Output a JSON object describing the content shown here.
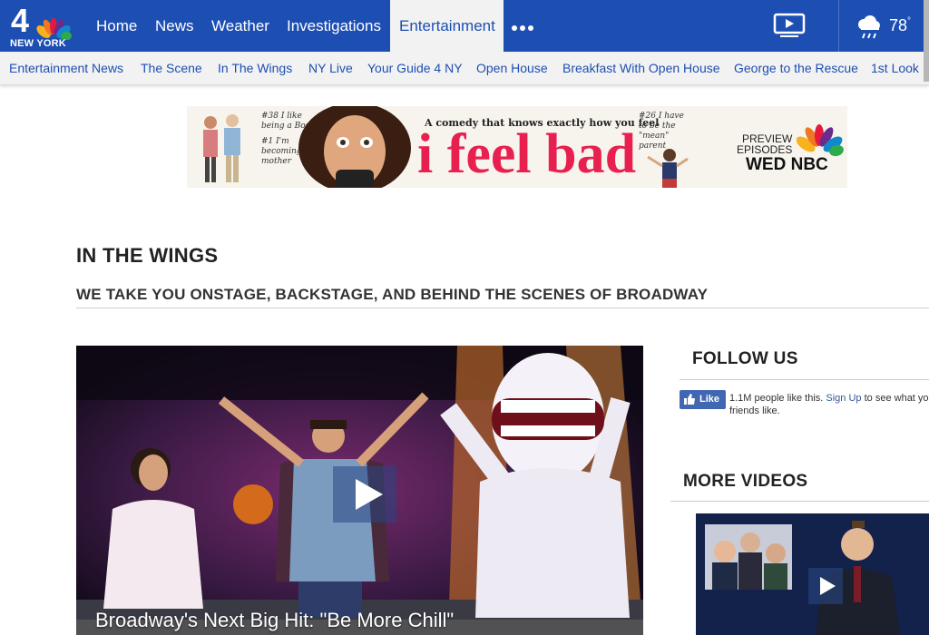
{
  "brand": {
    "logo_number": "4",
    "logo_city": "NEW YORK"
  },
  "nav": {
    "items": [
      "Home",
      "News",
      "Weather",
      "Investigations",
      "Entertainment"
    ],
    "active": "Entertainment",
    "weather_temp": "78",
    "weather_unit": "°"
  },
  "subnav": {
    "items": [
      "Entertainment News",
      "The Scene",
      "In The Wings",
      "NY Live",
      "Your Guide 4 NY",
      "Open House",
      "Breakfast With Open House",
      "George to the Rescue",
      "1st Look"
    ]
  },
  "ad": {
    "tagline": "A comedy that knows exactly how you feel",
    "title": "i feel bad",
    "note_left_1": "#38 I like being a Boss",
    "note_left_2": "#1 I'm becoming my mother",
    "note_right": "#26 I have to be the \"mean\" parent",
    "preview_line1": "PREVIEW",
    "preview_line2": "EPISODES",
    "wed": "WED",
    "network": "NBC"
  },
  "section": {
    "title": "IN THE WINGS",
    "subtitle": "WE TAKE YOU ONSTAGE, BACKSTAGE, AND BEHIND THE SCENES OF BROADWAY"
  },
  "main_video": {
    "caption": "Broadway's Next Big Hit: \"Be More Chill\""
  },
  "sidebar": {
    "follow_title": "FOLLOW US",
    "fb_like_label": "Like",
    "fb_count_text": "1.1M people like this.",
    "fb_signup": "Sign Up",
    "fb_rest": "to see what your",
    "fb_line2": "friends like.",
    "more_videos_title": "MORE VIDEOS"
  },
  "colors": {
    "nav_blue": "#1d4fb3",
    "subnav_bg": "#f2f2f2",
    "ad_pink": "#e8204f",
    "fb_blue": "#4267b2"
  }
}
